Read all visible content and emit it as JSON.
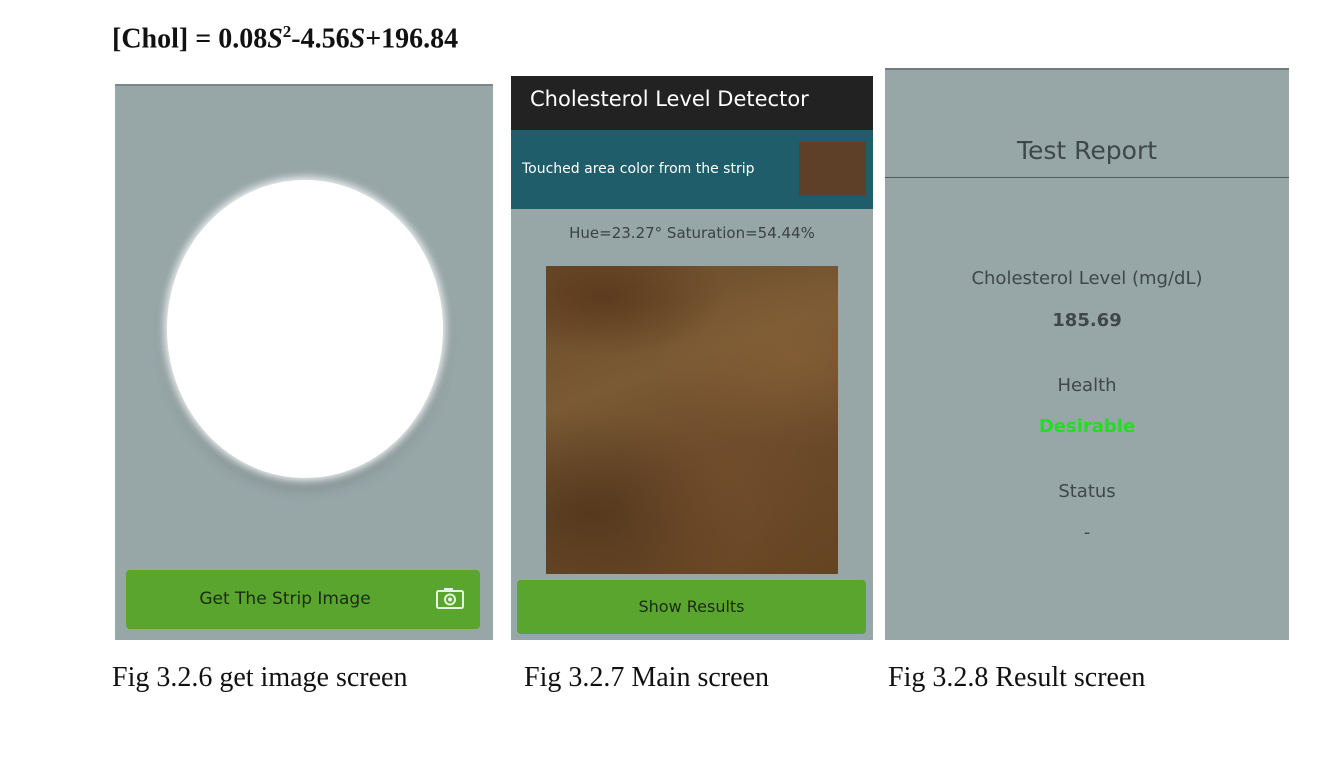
{
  "formula": {
    "lhs": "[Chol]",
    "eq": "=",
    "coef1": "0.08",
    "var1": "S",
    "exp": "2",
    "op1": "-4.56",
    "var2": "S",
    "tail": "+196.84"
  },
  "captions": {
    "fig1": "Fig 3.2.6 get image screen",
    "fig2": "Fig 3.2.7 Main screen",
    "fig3": "Fig 3.2.8 Result screen"
  },
  "screen1": {
    "button_label": "Get The Strip Image",
    "button_icon": "camera-icon"
  },
  "screen2": {
    "app_title": "Cholesterol Level Detector",
    "touched_label": "Touched area color from the strip",
    "swatch_color": "#5e3f28",
    "hue_saturation": "Hue=23.27°  Saturation=54.44%",
    "button_label": "Show Results"
  },
  "screen3": {
    "title": "Test Report",
    "cholesterol_label": "Cholesterol Level (mg/dL)",
    "cholesterol_value": "185.69",
    "health_label": "Health",
    "health_value": "Desirable",
    "health_color": "#22dd22",
    "status_label": "Status",
    "status_value": "-"
  },
  "colors": {
    "screen_bg": "#97a6a7",
    "button_green": "#5aa52d",
    "touched_bar": "#1f5d6a",
    "app_bar": "#222222"
  }
}
